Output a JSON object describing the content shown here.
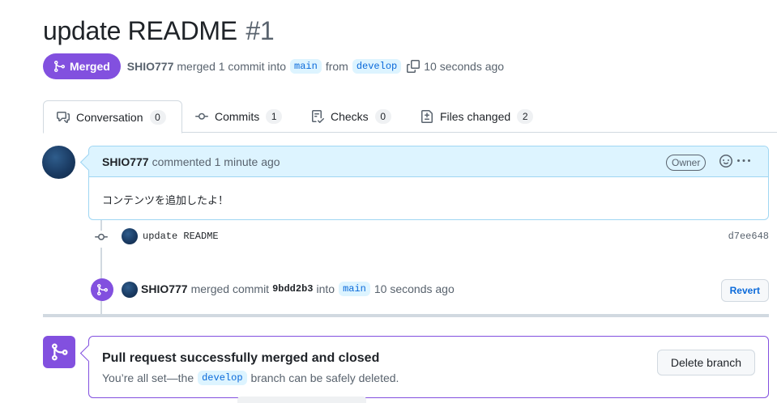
{
  "pr": {
    "title": "update README",
    "number": "#1",
    "state_label": "Merged",
    "author": "SHIO777",
    "merged_text": "merged 1 commit into",
    "base_branch": "main",
    "from_text": "from",
    "head_branch": "develop",
    "time": "10 seconds ago"
  },
  "tabs": [
    {
      "label": "Conversation",
      "count": "0",
      "icon": "conversation-icon"
    },
    {
      "label": "Commits",
      "count": "1",
      "icon": "commit-icon"
    },
    {
      "label": "Checks",
      "count": "0",
      "icon": "checklist-icon"
    },
    {
      "label": "Files changed",
      "count": "2",
      "icon": "file-diff-icon"
    }
  ],
  "comment": {
    "author": "SHIO777",
    "meta": "commented 1 minute ago",
    "role_label": "Owner",
    "body": "コンテンツを追加したよ！"
  },
  "commit": {
    "message": "update README",
    "sha": "d7ee648"
  },
  "merge_event": {
    "author": "SHIO777",
    "text1": "merged commit",
    "sha": "9bdd2b3",
    "text2": "into",
    "branch": "main",
    "time": "10 seconds ago",
    "revert_label": "Revert"
  },
  "merge_box": {
    "title": "Pull request successfully merged and closed",
    "desc_before": "You’re all set—the",
    "branch": "develop",
    "desc_after": "branch can be safely deleted.",
    "delete_label": "Delete branch"
  },
  "colors": {
    "merged_purple": "#8250df",
    "link_blue": "#0969da",
    "comment_header_bg": "#ddf4ff"
  }
}
